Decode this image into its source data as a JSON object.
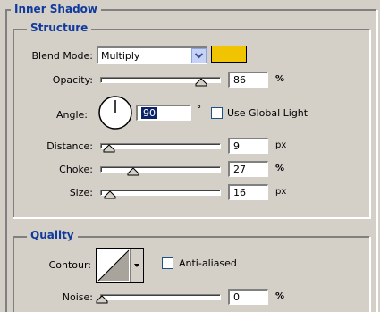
{
  "panel": {
    "title": "Inner Shadow"
  },
  "structure": {
    "title": "Structure",
    "blend_mode": {
      "label": "Blend Mode:",
      "value": "Multiply",
      "swatch_color": "#f0c400"
    },
    "opacity": {
      "label": "Opacity:",
      "value": "86",
      "unit": "%",
      "level": 0.86
    },
    "angle": {
      "label": "Angle:",
      "value": "90",
      "unit": "°",
      "degrees": 90
    },
    "use_global_light": {
      "label": "Use Global Light",
      "checked": false
    },
    "distance": {
      "label": "Distance:",
      "value": "9",
      "unit": "px",
      "level": 0.06
    },
    "choke": {
      "label": "Choke:",
      "value": "27",
      "unit": "%",
      "level": 0.27
    },
    "size": {
      "label": "Size:",
      "value": "16",
      "unit": "px",
      "level": 0.07
    }
  },
  "quality": {
    "title": "Quality",
    "contour": {
      "label": "Contour:"
    },
    "anti_aliased": {
      "label": "Anti-aliased",
      "checked": false
    },
    "noise": {
      "label": "Noise:",
      "value": "0",
      "unit": "%",
      "level": 0.0
    }
  },
  "colors": {
    "panel_bg": "#d4d0c8",
    "title_blue": "#103a9c"
  }
}
